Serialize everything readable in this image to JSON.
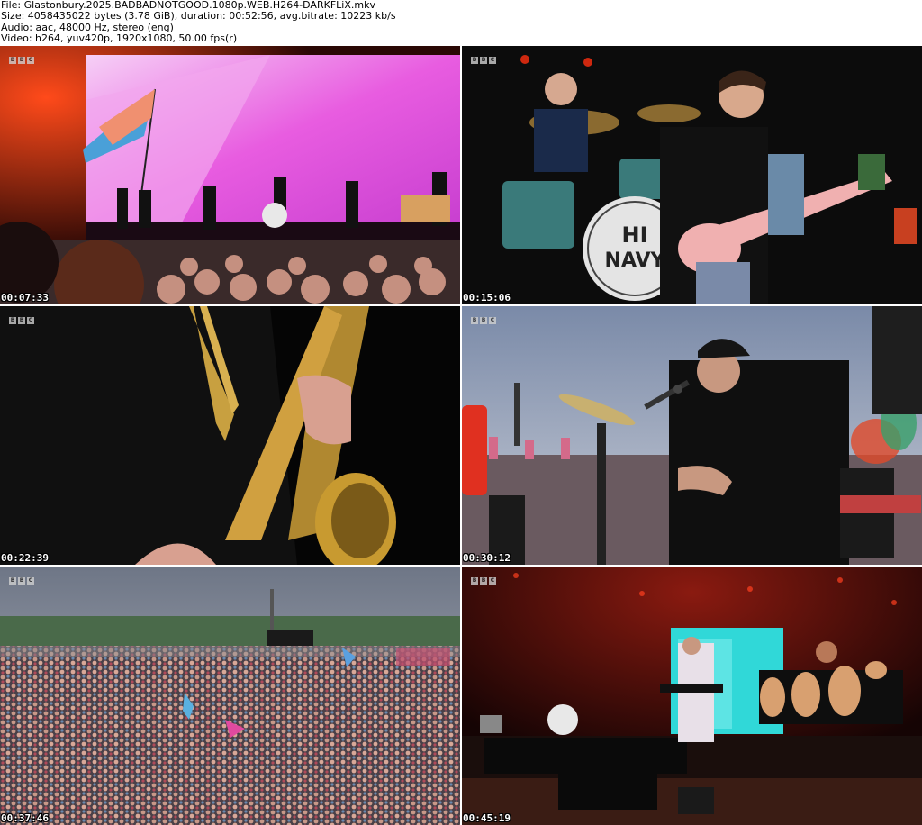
{
  "meta": {
    "file_line": "File: Glastonbury.2025.BADBADNOTGOOD.1080p.WEB.H264-DARKFLiX.mkv",
    "size_line": "Size: 4058435022 bytes (3.78 GiB), duration: 00:52:56, avg.bitrate: 10223 kb/s",
    "audio_line": "Audio: aac, 48000 Hz, stereo (eng)",
    "video_line": "Video: h264, yuv420p, 1920x1080, 50.00 fps(r)"
  },
  "frames": [
    {
      "timestamp": "00:07:33",
      "scene": "wide-stage-pink-screen"
    },
    {
      "timestamp": "00:15:06",
      "scene": "drummer-guitarist-closeup"
    },
    {
      "timestamp": "00:22:39",
      "scene": "saxophone-closeup"
    },
    {
      "timestamp": "00:30:12",
      "scene": "drummer-with-crowd"
    },
    {
      "timestamp": "00:37:46",
      "scene": "festival-crowd-wide"
    },
    {
      "timestamp": "00:45:19",
      "scene": "stage-green-screen"
    }
  ],
  "channel_logo": {
    "letters": [
      "B",
      "B",
      "C"
    ]
  },
  "drum_text": {
    "line1": "HI",
    "line2": "NAVY"
  }
}
